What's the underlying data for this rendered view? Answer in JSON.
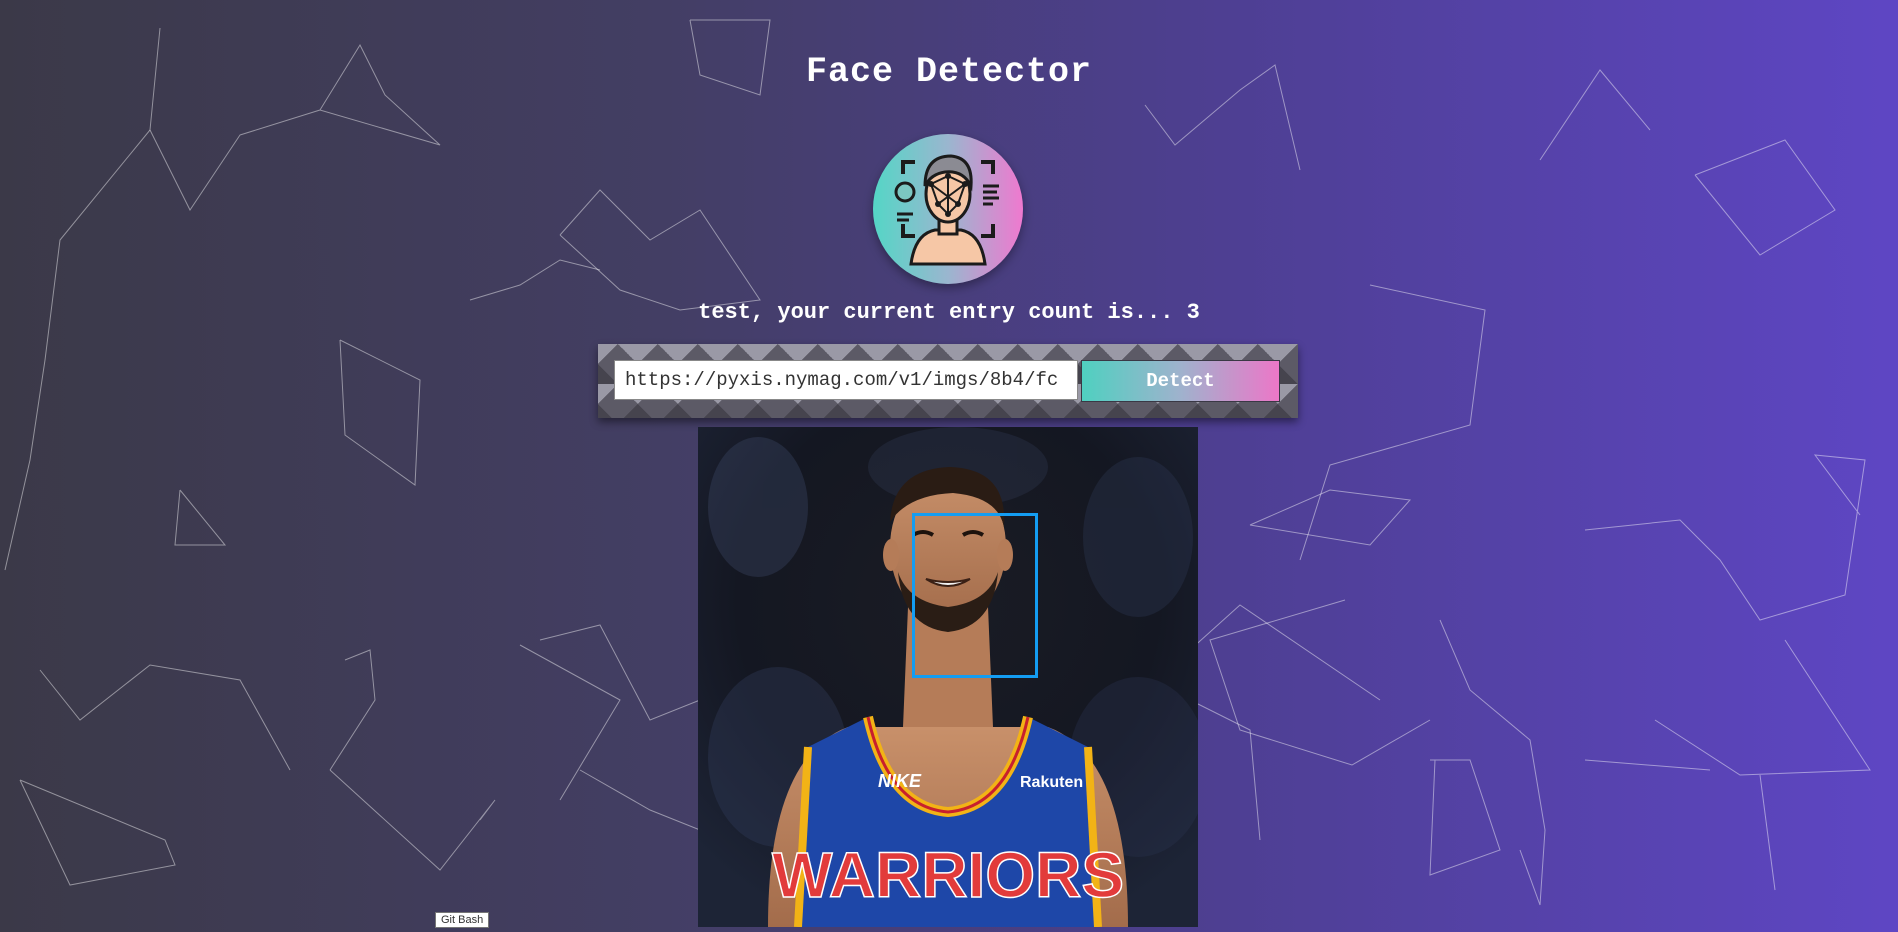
{
  "app": {
    "title": "Face Detector",
    "logo_icon": "face-recognition-icon"
  },
  "entry": {
    "text": "test, your current entry count is... 3"
  },
  "form": {
    "url_value": "https://pyxis.nymag.com/v1/imgs/8b4/fc",
    "detect_label": "Detect"
  },
  "image": {
    "subject_icon": "basketball-player-photo",
    "jersey_brand": "NIKE",
    "jersey_sponsor": "Rakuten",
    "jersey_team": "WARRIORS"
  },
  "tooltip": {
    "text": "Git Bash"
  },
  "colors": {
    "accent_teal": "#54d6c6",
    "accent_pink": "#ef79cf",
    "face_box": "#149df2"
  }
}
